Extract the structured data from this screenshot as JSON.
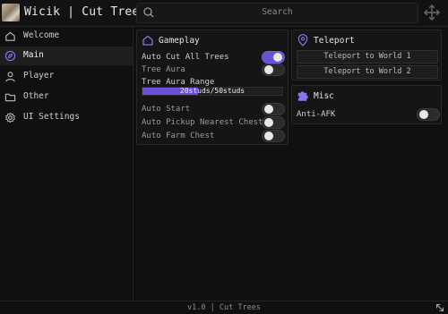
{
  "app": {
    "title": "Wicik | Cut Trees"
  },
  "search": {
    "placeholder": "Search"
  },
  "sidebar": {
    "items": [
      {
        "label": "Welcome",
        "icon": "home-icon",
        "active": false
      },
      {
        "label": "Main",
        "icon": "compass-icon",
        "active": true
      },
      {
        "label": "Player",
        "icon": "user-icon",
        "active": false
      },
      {
        "label": "Other",
        "icon": "folder-icon",
        "active": false
      },
      {
        "label": "UI Settings",
        "icon": "gear-icon",
        "active": false
      }
    ]
  },
  "gameplay": {
    "title": "Gameplay",
    "icon": "home-icon",
    "auto_cut": {
      "label": "Auto Cut All Trees",
      "enabled": true
    },
    "tree_aura": {
      "label": "Tree Aura",
      "enabled": false
    },
    "aura_range": {
      "label": "Tree Aura Range",
      "value_text": "20studs/50studs",
      "value": 20,
      "max": 50
    },
    "auto_start": {
      "label": "Auto Start",
      "enabled": false
    },
    "auto_pickup": {
      "label": "Auto Pickup Nearest Chest",
      "enabled": false
    },
    "auto_farm": {
      "label": "Auto Farm Chest",
      "enabled": false
    }
  },
  "teleport": {
    "title": "Teleport",
    "icon": "map-pin-icon",
    "buttons": [
      "Teleport to World 1",
      "Teleport to World 2"
    ]
  },
  "misc": {
    "title": "Misc",
    "icon": "puzzle-icon",
    "anti_afk": {
      "label": "Anti-AFK",
      "enabled": false
    }
  },
  "footer": {
    "text": "v1.0 | Cut Trees"
  },
  "colors": {
    "accent": "#6b4fd8",
    "background": "#101010",
    "panel": "#151515"
  }
}
